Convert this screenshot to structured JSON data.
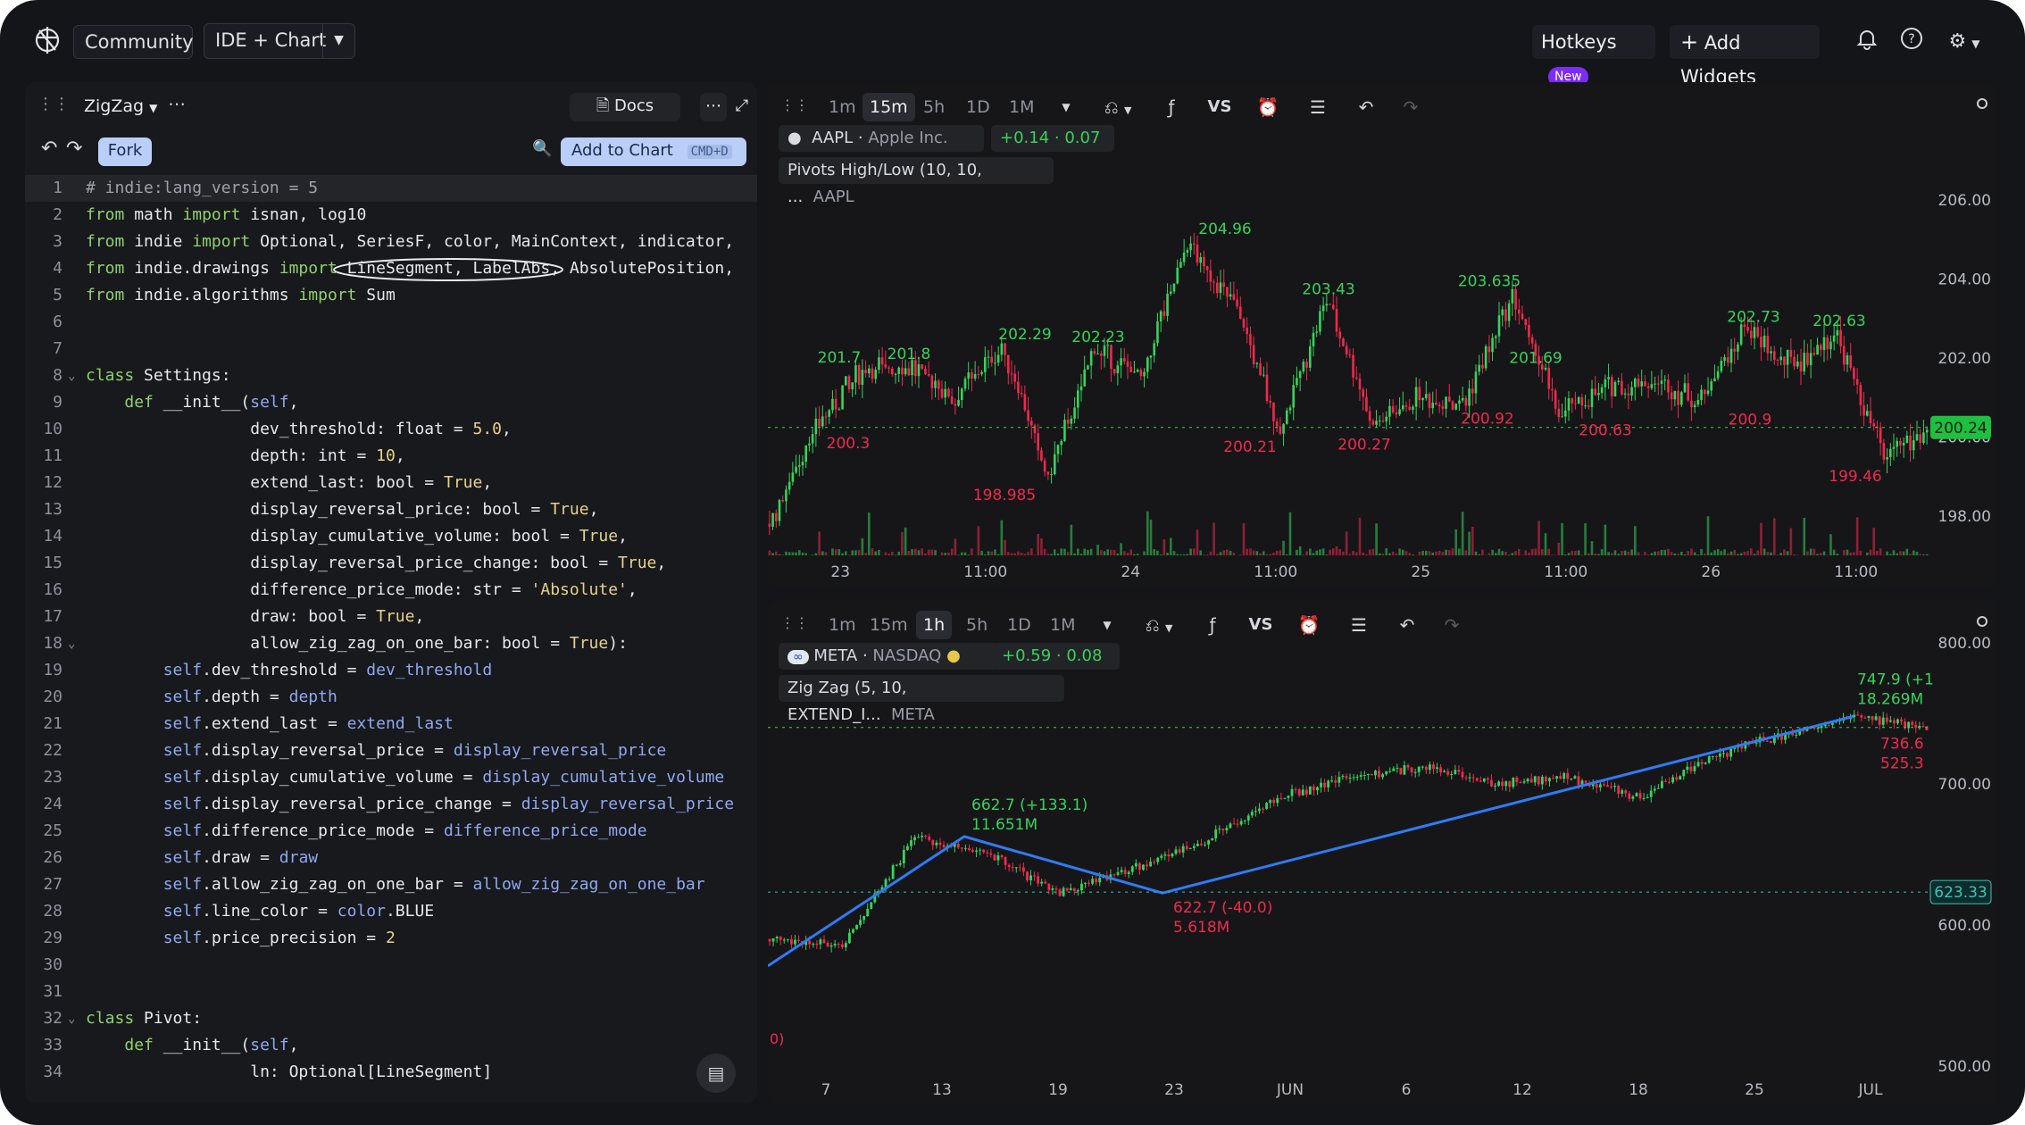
{
  "topbar": {
    "community": "Community",
    "layout": "IDE + Chart",
    "hotkeys": "Hotkeys",
    "new_badge": "New",
    "add_widgets": "Add Widgets"
  },
  "editor": {
    "file_name": "ZigZag",
    "docs": "Docs",
    "fork": "Fork",
    "add_to_chart": "Add to Chart",
    "shortcut": "CMD+D",
    "lines": [
      "# indie:lang_version = 5",
      "from math import isnan, log10",
      "from indie import Optional, SeriesF, color, MainContext, indicator,",
      "from indie.drawings import LineSegment, LabelAbs, AbsolutePosition,",
      "from indie.algorithms import Sum",
      "",
      "",
      "class Settings:",
      "    def __init__(self,",
      "                 dev_threshold: float = 5.0,",
      "                 depth: int = 10,",
      "                 extend_last: bool = True,",
      "                 display_reversal_price: bool = True,",
      "                 display_cumulative_volume: bool = True,",
      "                 display_reversal_price_change: bool = True,",
      "                 difference_price_mode: str = 'Absolute',",
      "                 draw: bool = True,",
      "                 allow_zig_zag_on_one_bar: bool = True):",
      "        self.dev_threshold = dev_threshold",
      "        self.depth = depth",
      "        self.extend_last = extend_last",
      "        self.display_reversal_price = display_reversal_price",
      "        self.display_cumulative_volume = display_cumulative_volume",
      "        self.display_reversal_price_change = display_reversal_price",
      "        self.difference_price_mode = difference_price_mode",
      "        self.draw = draw",
      "        self.allow_zig_zag_on_one_bar = allow_zig_zag_on_one_bar",
      "        self.line_color = color.BLUE",
      "        self.price_precision = 2",
      "",
      "",
      "class Pivot:",
      "    def __init__(self,",
      "                 ln: Optional[LineSegment]"
    ]
  },
  "chart1": {
    "timeframes": [
      "1m",
      "15m",
      "5h",
      "1D",
      "1M"
    ],
    "active_tf": "15m",
    "vs": "VS",
    "symbol": "AAPL",
    "name": "Apple Inc.",
    "change": "+0.14 · 0.07 %",
    "indicator": "Pivots High/Low (10, 10, ...",
    "indicator_symbol": "AAPL",
    "last_price": "200.24",
    "colors": {
      "up": "#37d35a",
      "down": "#f0294d"
    }
  },
  "chart2": {
    "timeframes": [
      "1m",
      "15m",
      "1h",
      "5h",
      "1D",
      "1M"
    ],
    "active_tf": "1h",
    "vs": "VS",
    "symbol": "META",
    "exchange": "NASDAQ",
    "change": "+0.59 · 0.08 %",
    "indicator": "Zig Zag (5, 10, EXTEND_I...",
    "indicator_symbol": "META",
    "last_price": "623.33",
    "left_clip": "0)",
    "line_color": "#2f7bf5"
  },
  "chart_data": [
    {
      "type": "candlestick",
      "title": "AAPL",
      "y_ticks": [
        "206.00",
        "204.00",
        "202.00",
        "200.00",
        "198.00"
      ],
      "x_ticks": [
        "23",
        "11:00",
        "24",
        "11:00",
        "25",
        "11:00",
        "26",
        "11:00"
      ],
      "ylim": [
        197,
        206.5
      ],
      "pivot_highs": [
        201.7,
        201.8,
        202.29,
        202.23,
        204.96,
        203.43,
        203.635,
        201.69,
        202.73,
        202.63
      ],
      "pivot_lows": [
        200.3,
        198.985,
        200.21,
        200.27,
        200.92,
        200.63,
        200.9,
        199.46
      ],
      "pivot_high_labels": [
        "201.7",
        "201.8",
        "202.29",
        "202.23",
        "204.96",
        "203.43",
        "203.635",
        "201.69",
        "202.73",
        "202.63"
      ],
      "pivot_low_labels": [
        "200.3",
        "198.985",
        "200.21",
        "200.27",
        "200.92",
        "200.63",
        "200.9",
        "199.46"
      ],
      "last": 200.24
    },
    {
      "type": "candlestick",
      "title": "META",
      "y_ticks": [
        "800.00",
        "700.00",
        "600.00",
        "500.00"
      ],
      "x_ticks": [
        "7",
        "13",
        "19",
        "23",
        "JUN",
        "6",
        "12",
        "18",
        "25",
        "JUL"
      ],
      "ylim": [
        495,
        805
      ],
      "zigzag_points": [
        {
          "label": "",
          "price": 571
        },
        {
          "label": "662.7 (+133.1)",
          "price": 662.7
        },
        {
          "label": "622.7 (-40.0)",
          "price": 622.7
        },
        {
          "label": "747.9 (+1",
          "price": 747.9
        }
      ],
      "annotations": [
        "662.7 (+133.1)",
        "11.651M",
        "622.7 (-40.0)",
        "5.618M",
        "747.9 (+1",
        "18.269M",
        "736.6",
        "525.3"
      ],
      "last": 623.33
    }
  ]
}
